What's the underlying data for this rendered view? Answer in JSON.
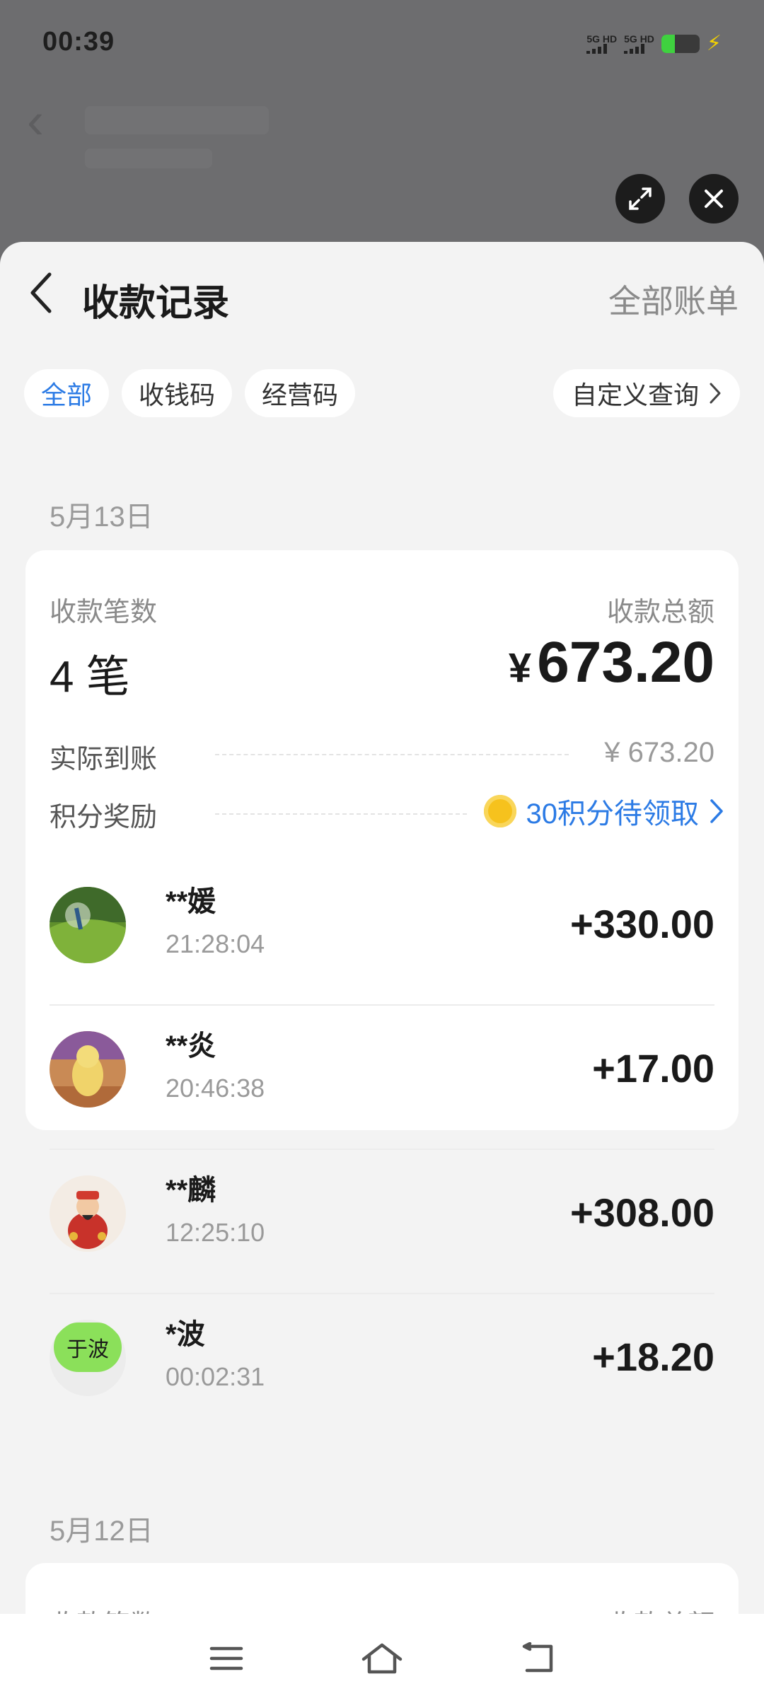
{
  "status_bar": {
    "time": "00:39",
    "sim1": "5G HD",
    "sim2": "5G HD",
    "battery_level": 0.35,
    "charging_icon": "bolt-icon"
  },
  "overlay": {
    "expand_icon": "expand-icon",
    "close_icon": "close-icon"
  },
  "header": {
    "title": "收款记录",
    "right_link": "全部账单"
  },
  "filters": {
    "chips": [
      {
        "label": "全部",
        "active": true
      },
      {
        "label": "收钱码",
        "active": false
      },
      {
        "label": "经营码",
        "active": false
      }
    ],
    "custom_query": "自定义查询"
  },
  "days": [
    {
      "date": "5月13日",
      "count_label": "收款笔数",
      "count": "4 笔",
      "total_label": "收款总额",
      "currency": "¥",
      "total": "673.20",
      "actual_label": "实际到账",
      "actual": "¥ 673.20",
      "reward_label": "积分奖励",
      "reward": "30积分待领取",
      "transactions": [
        {
          "name": "**媛",
          "time": "21:28:04",
          "amount": "+330.00"
        },
        {
          "name": "**炎",
          "time": "20:46:38",
          "amount": "+17.00"
        },
        {
          "name": "**麟",
          "time": "12:25:10",
          "amount": "+308.00"
        },
        {
          "name": "*波",
          "time": "00:02:31",
          "amount": "+18.20",
          "avatar_text": "于波"
        }
      ]
    },
    {
      "date": "5月12日",
      "count_label": "收款笔数",
      "total_label": "收款总额"
    }
  ],
  "colors": {
    "accent": "#2c7be5",
    "sheet_bg": "#f3f3f3",
    "card_bg": "#ffffff",
    "backdrop": "#6d6d6f"
  }
}
